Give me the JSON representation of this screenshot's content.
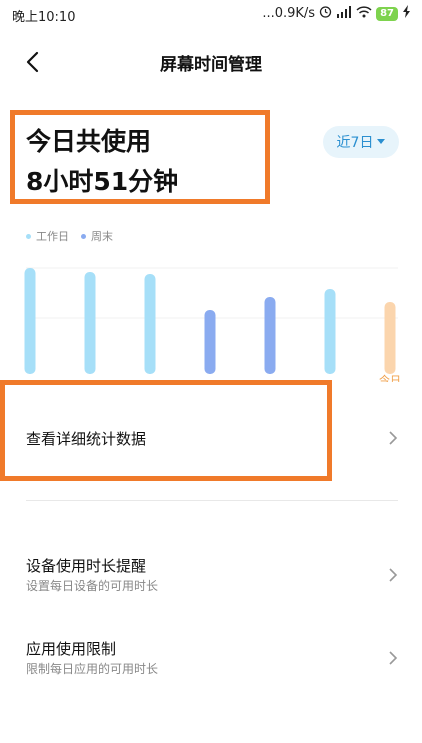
{
  "status_bar": {
    "time": "晚上10:10",
    "network_speed": "...0.9K/s",
    "battery": "87"
  },
  "header": {
    "title": "屏幕时间管理",
    "back_icon": "chevron-left-icon"
  },
  "summary": {
    "label": "今日共使用",
    "value": "8小时51分钟",
    "range_label": "近7日"
  },
  "legend": {
    "weekday": "工作日",
    "weekend": "周末"
  },
  "chart_data": {
    "type": "bar",
    "categories": [
      "",
      "",
      "",
      "",
      "",
      "",
      "今日"
    ],
    "values": [
      100,
      96,
      94,
      58,
      71,
      79,
      66
    ],
    "bar_colors": [
      "#a6dff8",
      "#a6dff8",
      "#a6dff8",
      "#8aabf0",
      "#8aabf0",
      "#a6dff8",
      "#fbd5ad"
    ],
    "ylim": [
      0,
      100
    ]
  },
  "menu": {
    "details": {
      "label": "查看详细统计数据"
    },
    "device_reminder": {
      "label": "设备使用时长提醒",
      "sub": "设置每日设备的可用时长"
    },
    "app_limit": {
      "label": "应用使用限制",
      "sub": "限制每日应用的可用时长"
    }
  },
  "colors": {
    "accent": "#2a8fd0",
    "annotation": "#f07a2a",
    "weekday_dot": "#a6dff8",
    "weekend_dot": "#8aabf0"
  }
}
